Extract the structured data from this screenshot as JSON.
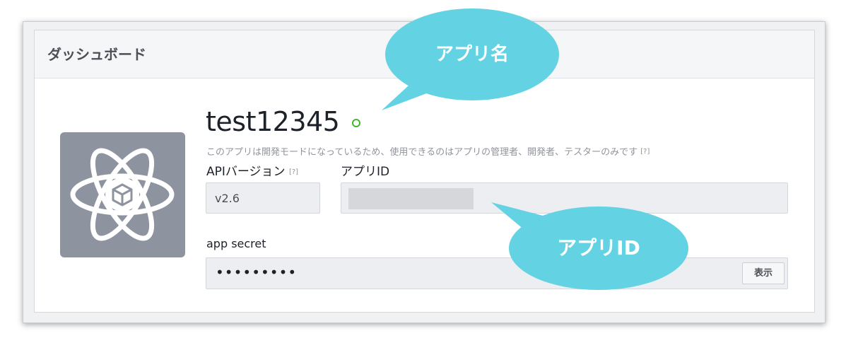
{
  "dashboard": {
    "title": "ダッシュボード",
    "app_name": "test12345",
    "dev_mode_note": "このアプリは開発モードになっているため、使用できるのはアプリの管理者、開発者、テスターのみです",
    "help_marker": "[?]",
    "api_version_label": "APIバージョン",
    "api_version_value": "v2.6",
    "app_id_label": "アプリID",
    "app_secret_label": "app secret",
    "app_secret_value": "•••••••••",
    "show_button_label": "表示"
  },
  "annotations": {
    "app_name_callout": "アプリ名",
    "app_id_callout": "アプリID"
  },
  "colors": {
    "callout": "#63d3e3",
    "status_dot": "#42b72a",
    "icon_bg": "#8e949f"
  },
  "icons": {
    "app_icon": "atom-cube-icon",
    "status": "status-circle-icon"
  }
}
